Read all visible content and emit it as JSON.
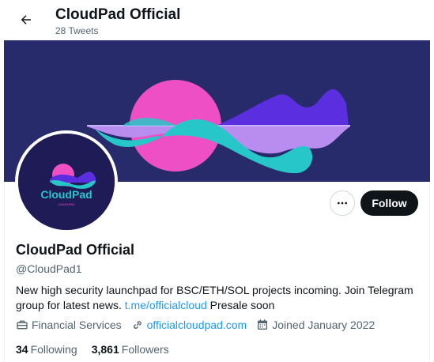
{
  "header": {
    "back_icon": "arrow-left-icon",
    "title": "CloudPad Official",
    "subtitle": "28 Tweets"
  },
  "avatar": {
    "logo_text": "CloudPad",
    "logo_tagline": "LAUNCHPAD"
  },
  "actions": {
    "more_icon": "ellipsis-icon",
    "follow_label": "Follow"
  },
  "profile": {
    "name": "CloudPad Official",
    "handle": "@CloudPad1",
    "bio_text": "New high security launchpad for BSC/ETH/SOL projects incoming. Join Telegram group for latest news. ",
    "bio_link": "t.me/officialcloud",
    "bio_tail": " Presale soon",
    "category": "Financial Services",
    "website": "officialcloudpad.com",
    "joined": "Joined January 2022"
  },
  "stats": {
    "following_count": "34",
    "following_label": "Following",
    "followers_count": "3,861",
    "followers_label": "Followers"
  },
  "colors": {
    "banner_bg": "#272a6b",
    "pink": "#ee4fc4",
    "purple": "#5b2ee0",
    "cyan": "#27c7c9",
    "lavender": "#b98cf0",
    "link": "#1d9bf0"
  }
}
